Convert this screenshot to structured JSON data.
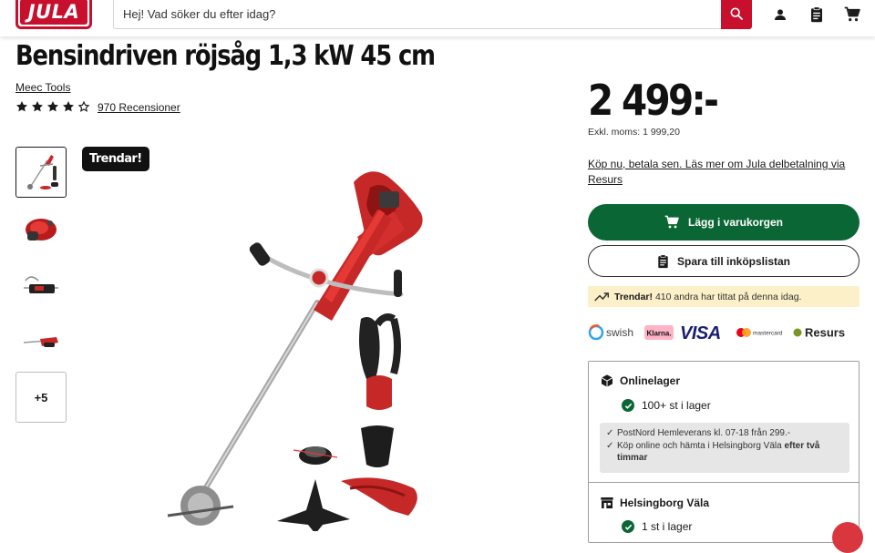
{
  "header": {
    "logo_text": "JULA",
    "search": {
      "placeholder": "Hej! Vad söker du efter idag?"
    },
    "icons": [
      "search-icon",
      "account-icon",
      "shopping-list-icon",
      "cart-icon"
    ],
    "accent": "#c8102e"
  },
  "product": {
    "title": "Bensindriven röjsåg 1,3 kW 45 cm",
    "brand": "Meec Tools",
    "rating": {
      "stars": 4,
      "max": 5,
      "reviews_label": "970 Recensioner"
    },
    "badge": "Trendar!",
    "gallery": {
      "thumbnails": [
        "trimmer",
        "engine",
        "handle",
        "tool-detail"
      ],
      "more_label": "+5"
    }
  },
  "buy": {
    "price": "2 499:-",
    "excl_vat": "Exkl. moms: 1 999,20",
    "installment_link": "Köp nu, betala sen. Läs mer om Jula delbetalning via Resurs",
    "add_to_cart_label": "Lägg i varukorgen",
    "save_list_label": "Spara till inköpslistan",
    "trend_note": {
      "bold": "Trendar!",
      "text": "410 andra har tittat på denna idag."
    },
    "payment_methods": [
      "swish",
      "Klarna.",
      "VISA",
      "mastercard",
      "Resurs"
    ],
    "cart_color": "#0a6634"
  },
  "stock": {
    "online": {
      "title": "Onlinelager",
      "status": "100+ st i lager",
      "delivery": [
        {
          "text": "PostNord Hemleverans kl. 07-18 från 299.-"
        },
        {
          "text": "Köp online och hämta i Helsingborg Väla ",
          "bold": "efter två timmar"
        }
      ]
    },
    "store": {
      "title": "Helsingborg Väla",
      "status": "1 st i lager"
    }
  }
}
